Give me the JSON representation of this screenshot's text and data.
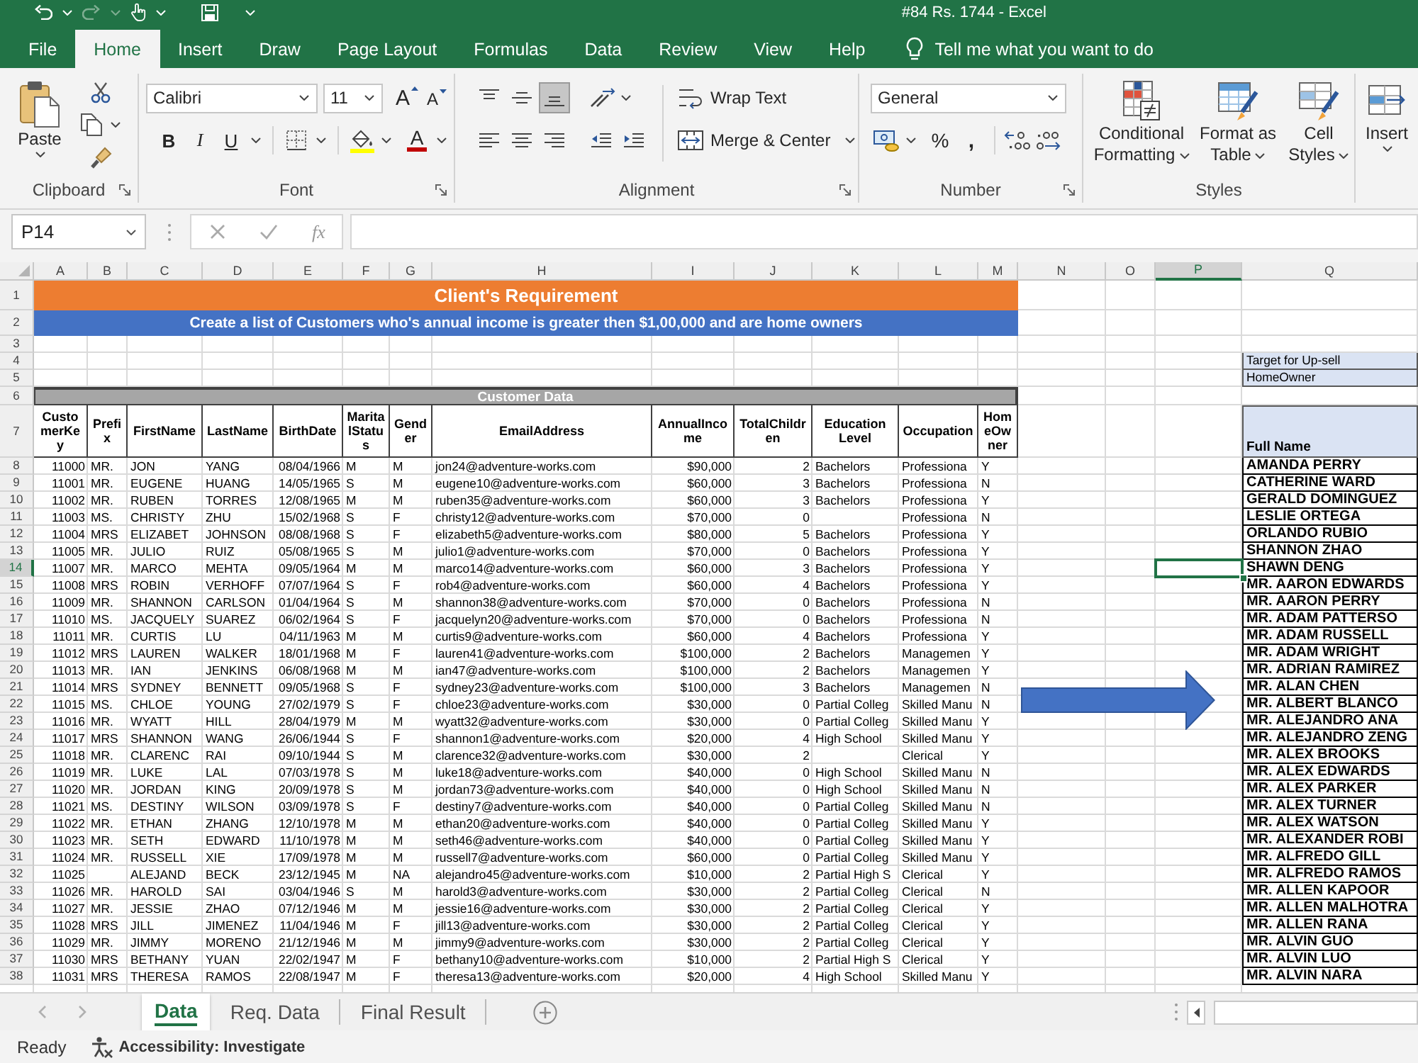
{
  "title_bar": {
    "title": "#84 Rs. 1744 - Excel"
  },
  "ribbon_tabs": [
    {
      "label": "File",
      "selected": false
    },
    {
      "label": "Home",
      "selected": true
    },
    {
      "label": "Insert",
      "selected": false
    },
    {
      "label": "Draw",
      "selected": false
    },
    {
      "label": "Page Layout",
      "selected": false
    },
    {
      "label": "Formulas",
      "selected": false
    },
    {
      "label": "Data",
      "selected": false
    },
    {
      "label": "Review",
      "selected": false
    },
    {
      "label": "View",
      "selected": false
    },
    {
      "label": "Help",
      "selected": false
    }
  ],
  "tell_me": {
    "placeholder": "Tell me what you want to do"
  },
  "ribbon": {
    "clipboard": {
      "label": "Clipboard",
      "paste": "Paste"
    },
    "font": {
      "label": "Font",
      "font_name": "Calibri",
      "font_size": "11",
      "grow": "A",
      "shrink": "A",
      "bold": "B",
      "italic": "I",
      "underline": "U",
      "font_color": "A"
    },
    "alignment": {
      "label": "Alignment",
      "vertical": [
        {
          "kind": "top",
          "selected": false
        },
        {
          "kind": "middle",
          "selected": false
        },
        {
          "kind": "bottom",
          "selected": true
        }
      ],
      "wrap_text": "Wrap Text",
      "merge": "Merge & Center"
    },
    "number": {
      "label": "Number",
      "format": "General",
      "percent": "%",
      "comma": ","
    },
    "styles": {
      "label": "Styles",
      "buttons": [
        {
          "kind": "conditional",
          "label": "Conditional Formatting"
        },
        {
          "kind": "table",
          "label": "Format as Table"
        },
        {
          "kind": "cell",
          "label": "Cell Styles"
        }
      ]
    },
    "cells": {
      "insert": "Insert"
    }
  },
  "formula_bar": {
    "name_box": "P14",
    "function_label": "fx"
  },
  "sheet": {
    "columns": [
      {
        "label": "A",
        "selected": false
      },
      {
        "label": "B",
        "selected": false
      },
      {
        "label": "C",
        "selected": false
      },
      {
        "label": "D",
        "selected": false
      },
      {
        "label": "E",
        "selected": false
      },
      {
        "label": "F",
        "selected": false
      },
      {
        "label": "G",
        "selected": false
      },
      {
        "label": "H",
        "selected": false
      },
      {
        "label": "I",
        "selected": false
      },
      {
        "label": "J",
        "selected": false
      },
      {
        "label": "K",
        "selected": false
      },
      {
        "label": "L",
        "selected": false
      },
      {
        "label": "M",
        "selected": false
      },
      {
        "label": "N",
        "selected": false
      },
      {
        "label": "O",
        "selected": false
      },
      {
        "label": "P",
        "selected": true
      },
      {
        "label": "Q",
        "selected": false
      }
    ],
    "row_numbers": [
      {
        "label": "1",
        "selected": false
      },
      {
        "label": "2",
        "selected": false
      },
      {
        "label": "3",
        "selected": false
      },
      {
        "label": "4",
        "selected": false
      },
      {
        "label": "5",
        "selected": false
      },
      {
        "label": "6",
        "selected": false
      },
      {
        "label": "7",
        "selected": false
      },
      {
        "label": "8",
        "selected": false
      },
      {
        "label": "9",
        "selected": false
      },
      {
        "label": "10",
        "selected": false
      },
      {
        "label": "11",
        "selected": false
      },
      {
        "label": "12",
        "selected": false
      },
      {
        "label": "13",
        "selected": false
      },
      {
        "label": "14",
        "selected": true
      },
      {
        "label": "15",
        "selected": false
      },
      {
        "label": "16",
        "selected": false
      },
      {
        "label": "17",
        "selected": false
      },
      {
        "label": "18",
        "selected": false
      },
      {
        "label": "19",
        "selected": false
      },
      {
        "label": "20",
        "selected": false
      },
      {
        "label": "21",
        "selected": false
      },
      {
        "label": "22",
        "selected": false
      },
      {
        "label": "23",
        "selected": false
      },
      {
        "label": "24",
        "selected": false
      },
      {
        "label": "25",
        "selected": false
      },
      {
        "label": "26",
        "selected": false
      },
      {
        "label": "27",
        "selected": false
      },
      {
        "label": "28",
        "selected": false
      },
      {
        "label": "29",
        "selected": false
      },
      {
        "label": "30",
        "selected": false
      },
      {
        "label": "31",
        "selected": false
      },
      {
        "label": "32",
        "selected": false
      },
      {
        "label": "33",
        "selected": false
      },
      {
        "label": "34",
        "selected": false
      },
      {
        "label": "35",
        "selected": false
      },
      {
        "label": "36",
        "selected": false
      },
      {
        "label": "37",
        "selected": false
      },
      {
        "label": "38",
        "selected": false
      }
    ],
    "banner": "Client's Requirement",
    "requirement": "Create a list of Customers who's annual income is greater then $1,00,000 and are home owners",
    "section_title": "Customer Data",
    "upsell_labels": [
      "Target for Up-sell",
      "HomeOwner"
    ],
    "headers": [
      "CustomerKey",
      "Prefix",
      "FirstName",
      "LastName",
      "BirthDate",
      "MaritalStatus",
      "Gender",
      "EmailAddress",
      "AnnualIncome",
      "TotalChildren",
      "Education Level",
      "Occupation",
      "HomeOwner"
    ],
    "name_header": "Full Name",
    "records": [
      {
        "cells": [
          "11000",
          "MR.",
          "JON",
          "YANG",
          "08/04/1966",
          "M",
          "M",
          "jon24@adventure-works.com",
          "$90,000",
          "2",
          "Bachelors",
          "Professiona",
          "Y"
        ],
        "full_name": "AMANDA PERRY"
      },
      {
        "cells": [
          "11001",
          "MR.",
          "EUGENE",
          "HUANG",
          "14/05/1965",
          "S",
          "M",
          "eugene10@adventure-works.com",
          "$60,000",
          "3",
          "Bachelors",
          "Professiona",
          "N"
        ],
        "full_name": "CATHERINE WARD"
      },
      {
        "cells": [
          "11002",
          "MR.",
          "RUBEN",
          "TORRES",
          "12/08/1965",
          "M",
          "M",
          "ruben35@adventure-works.com",
          "$60,000",
          "3",
          "Bachelors",
          "Professiona",
          "Y"
        ],
        "full_name": "GERALD DOMINGUEZ"
      },
      {
        "cells": [
          "11003",
          "MS.",
          "CHRISTY",
          "ZHU",
          "15/02/1968",
          "S",
          "F",
          "christy12@adventure-works.com",
          "$70,000",
          "0",
          null,
          "Professiona",
          "N"
        ],
        "full_name": "LESLIE ORTEGA"
      },
      {
        "cells": [
          "11004",
          "MRS",
          "ELIZABET",
          "JOHNSON",
          "08/08/1968",
          "S",
          "F",
          "elizabeth5@adventure-works.com",
          "$80,000",
          "5",
          "Bachelors",
          "Professiona",
          "Y"
        ],
        "full_name": "ORLANDO RUBIO"
      },
      {
        "cells": [
          "11005",
          "MR.",
          "JULIO",
          "RUIZ",
          "05/08/1965",
          "S",
          "M",
          "julio1@adventure-works.com",
          "$70,000",
          "0",
          "Bachelors",
          "Professiona",
          "Y"
        ],
        "full_name": "SHANNON ZHAO"
      },
      {
        "cells": [
          "11007",
          "MR.",
          "MARCO",
          "MEHTA",
          "09/05/1964",
          "M",
          "M",
          "marco14@adventure-works.com",
          "$60,000",
          "3",
          "Bachelors",
          "Professiona",
          "Y"
        ],
        "full_name": "SHAWN DENG"
      },
      {
        "cells": [
          "11008",
          "MRS",
          "ROBIN",
          "VERHOFF",
          "07/07/1964",
          "S",
          "F",
          "rob4@adventure-works.com",
          "$60,000",
          "4",
          "Bachelors",
          "Professiona",
          "Y"
        ],
        "full_name": "MR. AARON EDWARDS"
      },
      {
        "cells": [
          "11009",
          "MR.",
          "SHANNON",
          "CARLSON",
          "01/04/1964",
          "S",
          "M",
          "shannon38@adventure-works.com",
          "$70,000",
          "0",
          "Bachelors",
          "Professiona",
          "N"
        ],
        "full_name": "MR. AARON PERRY"
      },
      {
        "cells": [
          "11010",
          "MS.",
          "JACQUELY",
          "SUAREZ",
          "06/02/1964",
          "S",
          "F",
          "jacquelyn20@adventure-works.com",
          "$70,000",
          "0",
          "Bachelors",
          "Professiona",
          "N"
        ],
        "full_name": "MR. ADAM PATTERSO"
      },
      {
        "cells": [
          "11011",
          "MR.",
          "CURTIS",
          "LU",
          "04/11/1963",
          "M",
          "M",
          "curtis9@adventure-works.com",
          "$60,000",
          "4",
          "Bachelors",
          "Professiona",
          "Y"
        ],
        "full_name": "MR. ADAM RUSSELL"
      },
      {
        "cells": [
          "11012",
          "MRS",
          "LAUREN",
          "WALKER",
          "18/01/1968",
          "M",
          "F",
          "lauren41@adventure-works.com",
          "$100,000",
          "2",
          "Bachelors",
          "Managemen",
          "Y"
        ],
        "full_name": "MR. ADAM WRIGHT"
      },
      {
        "cells": [
          "11013",
          "MR.",
          "IAN",
          "JENKINS",
          "06/08/1968",
          "M",
          "M",
          "ian47@adventure-works.com",
          "$100,000",
          "2",
          "Bachelors",
          "Managemen",
          "Y"
        ],
        "full_name": "MR. ADRIAN RAMIREZ"
      },
      {
        "cells": [
          "11014",
          "MRS",
          "SYDNEY",
          "BENNETT",
          "09/05/1968",
          "S",
          "F",
          "sydney23@adventure-works.com",
          "$100,000",
          "3",
          "Bachelors",
          "Managemen",
          "N"
        ],
        "full_name": "MR. ALAN CHEN"
      },
      {
        "cells": [
          "11015",
          "MS.",
          "CHLOE",
          "YOUNG",
          "27/02/1979",
          "S",
          "F",
          "chloe23@adventure-works.com",
          "$30,000",
          "0",
          "Partial Colleg",
          "Skilled Manu",
          "N"
        ],
        "full_name": "MR. ALBERT BLANCO"
      },
      {
        "cells": [
          "11016",
          "MR.",
          "WYATT",
          "HILL",
          "28/04/1979",
          "M",
          "M",
          "wyatt32@adventure-works.com",
          "$30,000",
          "0",
          "Partial Colleg",
          "Skilled Manu",
          "Y"
        ],
        "full_name": "MR. ALEJANDRO ANA"
      },
      {
        "cells": [
          "11017",
          "MRS",
          "SHANNON",
          "WANG",
          "26/06/1944",
          "S",
          "F",
          "shannon1@adventure-works.com",
          "$20,000",
          "4",
          "High School",
          "Skilled Manu",
          "Y"
        ],
        "full_name": "MR. ALEJANDRO ZENG"
      },
      {
        "cells": [
          "11018",
          "MR.",
          "CLARENC",
          "RAI",
          "09/10/1944",
          "S",
          "M",
          "clarence32@adventure-works.com",
          "$30,000",
          "2",
          null,
          "Clerical",
          "Y"
        ],
        "full_name": "MR. ALEX BROOKS"
      },
      {
        "cells": [
          "11019",
          "MR.",
          "LUKE",
          "LAL",
          "07/03/1978",
          "S",
          "M",
          "luke18@adventure-works.com",
          "$40,000",
          "0",
          "High School",
          "Skilled Manu",
          "N"
        ],
        "full_name": "MR. ALEX EDWARDS"
      },
      {
        "cells": [
          "11020",
          "MR.",
          "JORDAN",
          "KING",
          "20/09/1978",
          "S",
          "M",
          "jordan73@adventure-works.com",
          "$40,000",
          "0",
          "High School",
          "Skilled Manu",
          "N"
        ],
        "full_name": "MR. ALEX PARKER"
      },
      {
        "cells": [
          "11021",
          "MS.",
          "DESTINY",
          "WILSON",
          "03/09/1978",
          "S",
          "F",
          "destiny7@adventure-works.com",
          "$40,000",
          "0",
          "Partial Colleg",
          "Skilled Manu",
          "N"
        ],
        "full_name": "MR. ALEX TURNER"
      },
      {
        "cells": [
          "11022",
          "MR.",
          "ETHAN",
          "ZHANG",
          "12/10/1978",
          "M",
          "M",
          "ethan20@adventure-works.com",
          "$40,000",
          "0",
          "Partial Colleg",
          "Skilled Manu",
          "Y"
        ],
        "full_name": "MR. ALEX WATSON"
      },
      {
        "cells": [
          "11023",
          "MR.",
          "SETH",
          "EDWARD",
          "11/10/1978",
          "M",
          "M",
          "seth46@adventure-works.com",
          "$40,000",
          "0",
          "Partial Colleg",
          "Skilled Manu",
          "Y"
        ],
        "full_name": "MR. ALEXANDER ROBI"
      },
      {
        "cells": [
          "11024",
          "MR.",
          "RUSSELL",
          "XIE",
          "17/09/1978",
          "M",
          "M",
          "russell7@adventure-works.com",
          "$60,000",
          "0",
          "Partial Colleg",
          "Skilled Manu",
          "Y"
        ],
        "full_name": "MR. ALFREDO GILL"
      },
      {
        "cells": [
          "11025",
          null,
          "ALEJAND",
          "BECK",
          "23/12/1945",
          "M",
          "NA",
          "alejandro45@adventure-works.com",
          "$10,000",
          "2",
          "Partial High S",
          "Clerical",
          "Y"
        ],
        "full_name": "MR. ALFREDO RAMOS"
      },
      {
        "cells": [
          "11026",
          "MR.",
          "HAROLD",
          "SAI",
          "03/04/1946",
          "S",
          "M",
          "harold3@adventure-works.com",
          "$30,000",
          "2",
          "Partial Colleg",
          "Clerical",
          "N"
        ],
        "full_name": "MR. ALLEN KAPOOR"
      },
      {
        "cells": [
          "11027",
          "MR.",
          "JESSIE",
          "ZHAO",
          "07/12/1946",
          "M",
          "M",
          "jessie16@adventure-works.com",
          "$30,000",
          "2",
          "Partial Colleg",
          "Clerical",
          "Y"
        ],
        "full_name": "MR. ALLEN MALHOTRA"
      },
      {
        "cells": [
          "11028",
          "MRS",
          "JILL",
          "JIMENEZ",
          "11/04/1946",
          "M",
          "F",
          "jill13@adventure-works.com",
          "$30,000",
          "2",
          "Partial Colleg",
          "Clerical",
          "Y"
        ],
        "full_name": "MR. ALLEN RANA"
      },
      {
        "cells": [
          "11029",
          "MR.",
          "JIMMY",
          "MORENO",
          "21/12/1946",
          "M",
          "M",
          "jimmy9@adventure-works.com",
          "$30,000",
          "2",
          "Partial Colleg",
          "Clerical",
          "Y"
        ],
        "full_name": "MR. ALVIN GUO"
      },
      {
        "cells": [
          "11030",
          "MRS",
          "BETHANY",
          "YUAN",
          "22/02/1947",
          "M",
          "F",
          "bethany10@adventure-works.com",
          "$10,000",
          "2",
          "Partial High S",
          "Clerical",
          "Y"
        ],
        "full_name": "MR. ALVIN LUO"
      },
      {
        "cells": [
          "11031",
          "MRS",
          "THERESA",
          "RAMOS",
          "22/08/1947",
          "M",
          "F",
          "theresa13@adventure-works.com",
          "$20,000",
          "4",
          "High School",
          "Skilled Manu",
          "Y"
        ],
        "full_name": "MR. ALVIN NARA"
      }
    ]
  },
  "sheet_tabs": [
    {
      "label": "Data",
      "selected": true
    },
    {
      "label": "Req. Data",
      "selected": false
    },
    {
      "label": "Final Result",
      "selected": false
    }
  ],
  "status_bar": {
    "status": "Ready",
    "accessibility": "Accessibility: Investigate"
  }
}
